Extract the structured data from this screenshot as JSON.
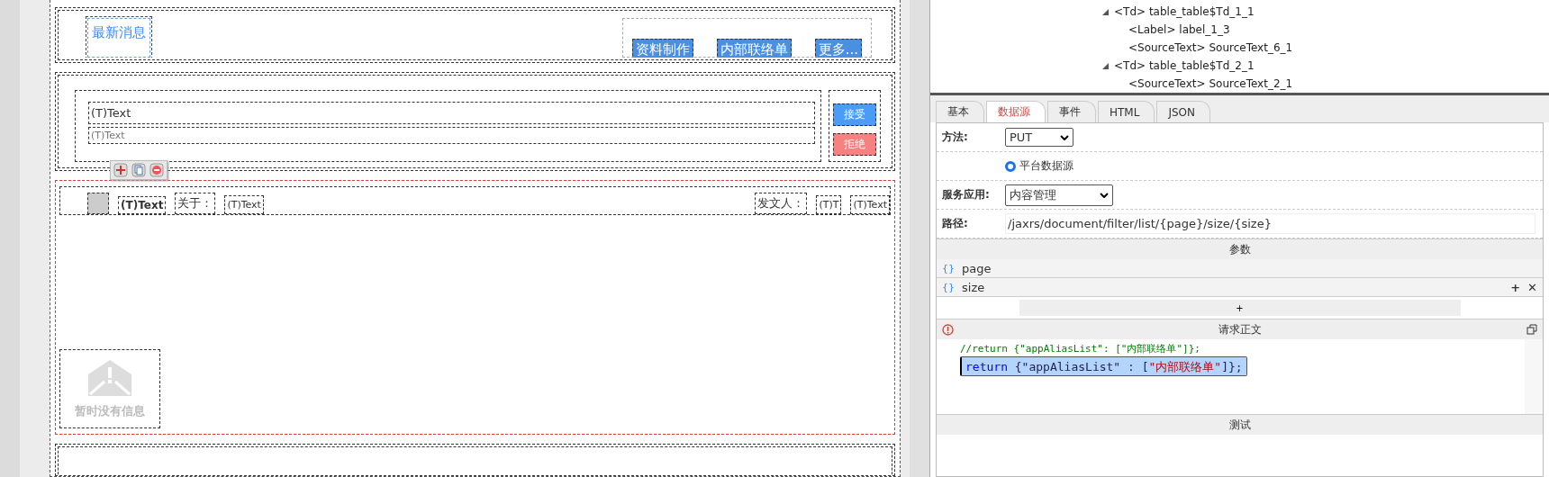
{
  "designer": {
    "news": {
      "title": "最新消息",
      "tabs": [
        "资料制作",
        "内部联络单",
        "更多..."
      ]
    },
    "todo": {
      "title_text": "(T)Text",
      "subtitle_text": "(T)Text",
      "buttons": [
        {
          "label": "接受",
          "kind": "accept"
        },
        {
          "label": "拒绝",
          "kind": "reject"
        }
      ]
    },
    "list_row": [
      {
        "kind": "square"
      },
      {
        "kind": "bold",
        "text": "(T)Text"
      },
      {
        "kind": "label",
        "text": "关于："
      },
      {
        "kind": "value",
        "text": "(T)Text"
      },
      {
        "kind": "spacer"
      },
      {
        "kind": "label",
        "text": "发文人："
      },
      {
        "kind": "value",
        "text": "(T)T"
      },
      {
        "kind": "value",
        "text": "(T)Text"
      }
    ],
    "empty": {
      "message": "暂时没有信息"
    }
  },
  "outline": {
    "items": [
      {
        "tag": "<Td>",
        "name": "table_table$Td_1_1",
        "expanded": true,
        "children": [
          {
            "tag": "<Label>",
            "name": "label_1_3"
          },
          {
            "tag": "<SourceText>",
            "name": "SourceText_6_1"
          }
        ]
      },
      {
        "tag": "<Td>",
        "name": "table_table$Td_2_1",
        "expanded": true,
        "children": [
          {
            "tag": "<SourceText>",
            "name": "SourceText_2_1"
          }
        ]
      }
    ]
  },
  "property_tabs": [
    {
      "label": "基本",
      "selected": false
    },
    {
      "label": "数据源",
      "selected": true
    },
    {
      "label": "事件",
      "selected": false
    },
    {
      "label": "HTML",
      "selected": false
    },
    {
      "label": "JSON",
      "selected": false
    }
  ],
  "form": {
    "method_label": "方法:",
    "method": "PUT",
    "source_option": {
      "label": "平台数据源",
      "selected": true
    },
    "service_label": "服务应用:",
    "service": "内容管理",
    "path_label": "路径:",
    "path": "/jaxrs/document/filter/list/{page}/size/{size}"
  },
  "params": {
    "title": "参数",
    "items": [
      {
        "icon": "{}",
        "name": "page"
      },
      {
        "icon": "{}",
        "name": "size",
        "actions": [
          "+",
          "✕"
        ]
      }
    ],
    "add": "+"
  },
  "body": {
    "title": "请求正文",
    "lines": [
      {
        "selected": false,
        "tokens": [
          {
            "kind": "comment",
            "text": "//return {\"appAliasList\": [\"内部联络单\"]};"
          }
        ]
      },
      {
        "selected": true,
        "tokens": [
          {
            "kind": "keyword",
            "text": "return"
          },
          {
            "kind": "plain",
            "text": " {\"appAliasList\" : ["
          },
          {
            "kind": "string",
            "text": "\"内部联络单\""
          },
          {
            "kind": "plain",
            "text": "]};"
          }
        ]
      }
    ]
  },
  "test": {
    "title": "测试"
  }
}
